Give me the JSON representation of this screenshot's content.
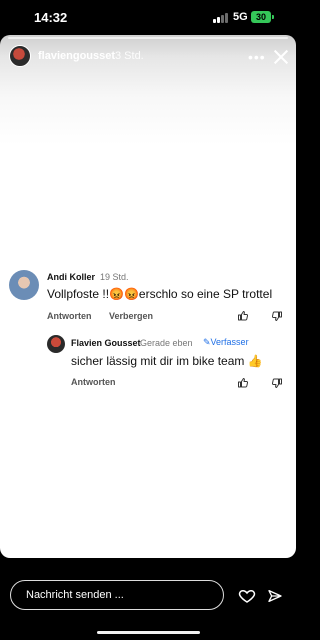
{
  "status_bar": {
    "time": "14:32",
    "network": "5G",
    "battery": "30"
  },
  "story": {
    "username": "flaviengousset",
    "time": "3 Std."
  },
  "comment": {
    "author": "Andi Koller",
    "time": "19 Std.",
    "text": "Vollpfoste !!😡😡erschlo so eine SP trottel",
    "reply_label": "Antworten",
    "hide_label": "Verbergen"
  },
  "reply": {
    "author": "Flavien Gousset",
    "time": "Gerade eben",
    "author_badge": "Verfasser",
    "text": "sicher lässig mit dir im bike team 👍",
    "reply_label": "Antworten"
  },
  "composer": {
    "placeholder": "Nachricht senden ..."
  }
}
